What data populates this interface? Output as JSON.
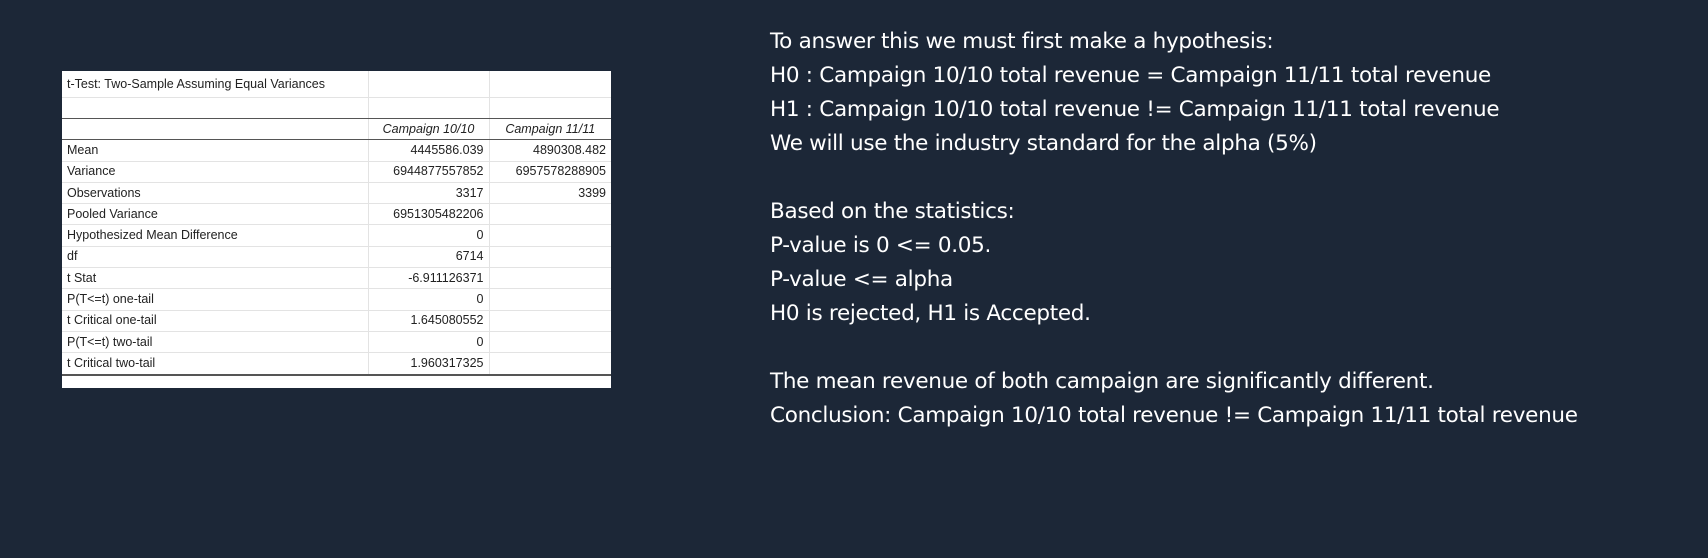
{
  "table": {
    "title": "t-Test: Two-Sample Assuming Equal Variances",
    "col_headers": [
      "Campaign 10/10",
      "Campaign 11/11"
    ],
    "rows": [
      {
        "label": "Mean",
        "v1": "4445586.039",
        "v2": "4890308.482"
      },
      {
        "label": "Variance",
        "v1": "6944877557852",
        "v2": "6957578288905"
      },
      {
        "label": "Observations",
        "v1": "3317",
        "v2": "3399"
      },
      {
        "label": "Pooled Variance",
        "v1": "6951305482206",
        "v2": ""
      },
      {
        "label": "Hypothesized Mean Difference",
        "v1": "0",
        "v2": ""
      },
      {
        "label": "df",
        "v1": "6714",
        "v2": ""
      },
      {
        "label": "t Stat",
        "v1": "-6.911126371",
        "v2": ""
      },
      {
        "label": "P(T<=t) one-tail",
        "v1": "0",
        "v2": ""
      },
      {
        "label": "t Critical one-tail",
        "v1": "1.645080552",
        "v2": ""
      },
      {
        "label": "P(T<=t) two-tail",
        "v1": "0",
        "v2": ""
      },
      {
        "label": "t Critical two-tail",
        "v1": "1.960317325",
        "v2": ""
      }
    ]
  },
  "text": {
    "hypothesis_intro": "To answer this we must first make a hypothesis:",
    "h0": "H0 : Campaign 10/10 total revenue = Campaign 11/11 total revenue",
    "h1": "H1 : Campaign 10/10 total revenue != Campaign 11/11 total revenue",
    "alpha": "We will use the industry standard for the alpha (5%)",
    "stats_intro": "Based on the statistics:",
    "pvalue": "P-value is 0 <= 0.05.",
    "pvalue_alpha": "P-value <= alpha",
    "result": "H0 is rejected, H1 is Accepted.",
    "mean_diff": "The mean revenue of both campaign are significantly different.",
    "conclusion": "Conclusion: Campaign 10/10 total revenue != Campaign 11/11 total revenue"
  }
}
